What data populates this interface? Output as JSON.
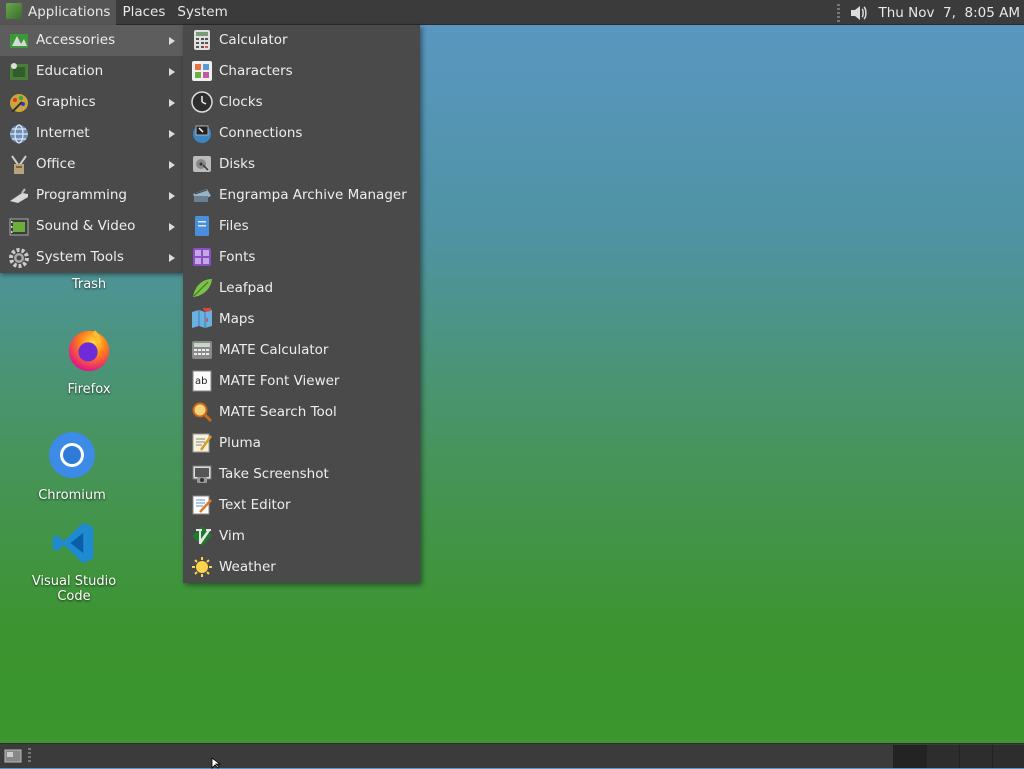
{
  "top_panel": {
    "menus": [
      "Applications",
      "Places",
      "System"
    ],
    "clock": "Thu Nov  7,  8:05 AM"
  },
  "desktop": {
    "icons": [
      "Trash",
      "Firefox",
      "Chromium",
      "Visual Studio Code"
    ]
  },
  "applications_menu": {
    "categories": [
      {
        "label": "Accessories",
        "icon": "accessories-icon"
      },
      {
        "label": "Education",
        "icon": "education-icon"
      },
      {
        "label": "Graphics",
        "icon": "graphics-icon"
      },
      {
        "label": "Internet",
        "icon": "internet-icon"
      },
      {
        "label": "Office",
        "icon": "office-icon"
      },
      {
        "label": "Programming",
        "icon": "programming-icon"
      },
      {
        "label": "Sound & Video",
        "icon": "sound-video-icon"
      },
      {
        "label": "System Tools",
        "icon": "system-tools-icon"
      }
    ],
    "active_category": "Accessories",
    "accessories": [
      {
        "label": "Calculator",
        "icon": "calculator-icon"
      },
      {
        "label": "Characters",
        "icon": "characters-icon"
      },
      {
        "label": "Clocks",
        "icon": "clocks-icon"
      },
      {
        "label": "Connections",
        "icon": "connections-icon"
      },
      {
        "label": "Disks",
        "icon": "disks-icon"
      },
      {
        "label": "Engrampa Archive Manager",
        "icon": "archive-manager-icon"
      },
      {
        "label": "Files",
        "icon": "files-icon"
      },
      {
        "label": "Fonts",
        "icon": "fonts-icon"
      },
      {
        "label": "Leafpad",
        "icon": "leafpad-icon"
      },
      {
        "label": "Maps",
        "icon": "maps-icon"
      },
      {
        "label": "MATE Calculator",
        "icon": "mate-calculator-icon"
      },
      {
        "label": "MATE Font Viewer",
        "icon": "font-viewer-icon"
      },
      {
        "label": "MATE Search Tool",
        "icon": "search-tool-icon"
      },
      {
        "label": "Pluma",
        "icon": "pluma-icon"
      },
      {
        "label": "Take Screenshot",
        "icon": "screenshot-icon"
      },
      {
        "label": "Text Editor",
        "icon": "text-editor-icon"
      },
      {
        "label": "Vim",
        "icon": "vim-icon"
      },
      {
        "label": "Weather",
        "icon": "weather-icon"
      }
    ]
  },
  "colors": {
    "panel": "#3b3b3b",
    "menu_bg": "#4a4a4a",
    "menu_highlight": "#5d5d5d",
    "desktop_top": "#5b97c4",
    "desktop_bottom": "#3a962c"
  }
}
